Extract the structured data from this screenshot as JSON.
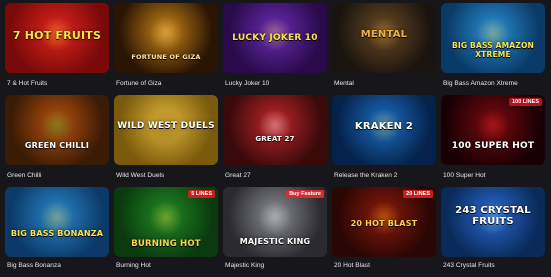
{
  "games": [
    {
      "caption": "7 & Hot Fruits",
      "art_title": "7 HOT FRUITS",
      "badge": "",
      "colors": [
        "#7a0a0a",
        "#e0241b",
        "#ffcf3a"
      ]
    },
    {
      "caption": "Fortune of Giza",
      "art_title": "FORTUNE OF GIZA",
      "badge": "",
      "colors": [
        "#2a1404",
        "#c98416",
        "#f2d27a"
      ]
    },
    {
      "caption": "Lucky Joker 10",
      "art_title": "LUCKY JOKER 10",
      "badge": "",
      "colors": [
        "#2a0a4a",
        "#6a2bb4",
        "#f4d24a"
      ]
    },
    {
      "caption": "Mental",
      "art_title": "MENTAL",
      "badge": "",
      "colors": [
        "#1a1410",
        "#6b4a22",
        "#d8a245"
      ]
    },
    {
      "caption": "Big Bass Amazon Xtreme",
      "art_title": "BIG BASS AMAZON XTREME",
      "badge": "",
      "colors": [
        "#0a3a66",
        "#2b8fd6",
        "#ffd23a"
      ]
    },
    {
      "caption": "Green Chilli",
      "art_title": "GREEN CHILLI",
      "badge": "",
      "colors": [
        "#3a1b05",
        "#b8520d",
        "#2ec33a"
      ]
    },
    {
      "caption": "Wild West Duels",
      "art_title": "WILD WEST DUELS",
      "badge": "",
      "colors": [
        "#7a5a0c",
        "#e0b53a",
        "#6b3a10"
      ]
    },
    {
      "caption": "Great 27",
      "art_title": "GREAT 27",
      "badge": "",
      "colors": [
        "#3a0a0a",
        "#c1262a",
        "#ffffff"
      ]
    },
    {
      "caption": "Release the Kraken 2",
      "art_title": "KRAKEN 2",
      "badge": "",
      "colors": [
        "#06224a",
        "#1b6fc4",
        "#f0d04a"
      ]
    },
    {
      "caption": "100 Super Hot",
      "art_title": "100 SUPER HOT",
      "badge": "100 LINES",
      "colors": [
        "#1a0004",
        "#7a0a10",
        "#ff2a2a"
      ]
    },
    {
      "caption": "Big Bass Bonanza",
      "art_title": "BIG BASS BONANZA",
      "badge": "",
      "colors": [
        "#0b3a6a",
        "#2a86c8",
        "#ffd33a"
      ]
    },
    {
      "caption": "Burning Hot",
      "art_title": "BURNING HOT",
      "badge": "5 LINES",
      "colors": [
        "#0b3a0e",
        "#1f8a25",
        "#ffcf3a"
      ]
    },
    {
      "caption": "Majestic King",
      "art_title": "MAJESTIC KING",
      "badge": "Buy Feature",
      "colors": [
        "#2a2a30",
        "#8c8c94",
        "#e6e6ea"
      ]
    },
    {
      "caption": "20 Hot Blast",
      "art_title": "20 HOT BLAST",
      "badge": "20 LINES",
      "colors": [
        "#2a0604",
        "#8a1a0a",
        "#ffb21a"
      ]
    },
    {
      "caption": "243 Crystal Fruits",
      "art_title": "243 CRYSTAL FRUITS",
      "badge": "",
      "colors": [
        "#0a2a5a",
        "#2a6ad0",
        "#9fe0ff"
      ]
    }
  ]
}
